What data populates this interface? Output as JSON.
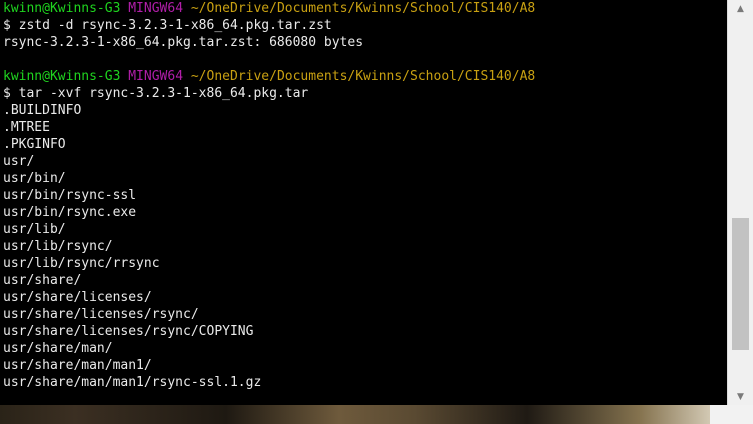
{
  "terminal": {
    "prompt1": {
      "user": "kwinn@Kwinns-G3",
      "host": "MINGW64",
      "path": "~/OneDrive/Documents/Kwinns/School/CIS140/A8"
    },
    "cmd1": "$ zstd -d rsync-3.2.3-1-x86_64.pkg.tar.zst",
    "out1": "rsync-3.2.3-1-x86_64.pkg.tar.zst: 686080 bytes",
    "prompt2": {
      "user": "kwinn@Kwinns-G3",
      "host": "MINGW64",
      "path": "~/OneDrive/Documents/Kwinns/School/CIS140/A8"
    },
    "cmd2": "$ tar -xvf rsync-3.2.3-1-x86_64.pkg.tar",
    "output": [
      ".BUILDINFO",
      ".MTREE",
      ".PKGINFO",
      "usr/",
      "usr/bin/",
      "usr/bin/rsync-ssl",
      "usr/bin/rsync.exe",
      "usr/lib/",
      "usr/lib/rsync/",
      "usr/lib/rsync/rrsync",
      "usr/share/",
      "usr/share/licenses/",
      "usr/share/licenses/rsync/",
      "usr/share/licenses/rsync/COPYING",
      "usr/share/man/",
      "usr/share/man/man1/",
      "usr/share/man/man1/rsync-ssl.1.gz"
    ]
  },
  "scrollbar": {
    "up_icon": "▲",
    "down_icon": "▼"
  }
}
